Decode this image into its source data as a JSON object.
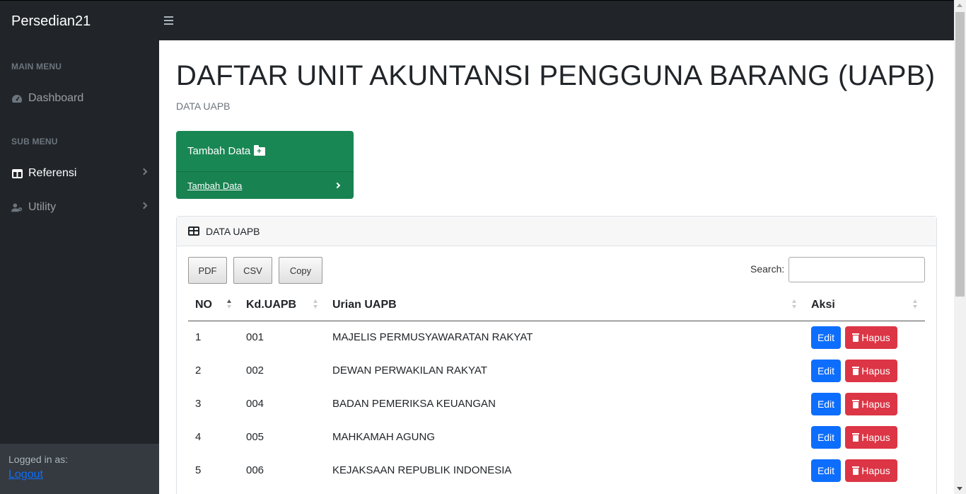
{
  "app": {
    "brand": "Persedian21"
  },
  "sidebar": {
    "main_menu_heading": "MAIN MENU",
    "sub_menu_heading": "SUB MENU",
    "items": [
      {
        "label": "Dashboard",
        "icon": "tachometer-icon"
      },
      {
        "label": "Referensi",
        "icon": "columns-icon",
        "has_submenu": true
      },
      {
        "label": "Utility",
        "icon": "user-cog-icon",
        "has_submenu": true
      }
    ],
    "footer": {
      "logged_in_label": "Logged in as:",
      "logout_label": "Logout"
    }
  },
  "page": {
    "title": "DAFTAR UNIT AKUNTANSI PENGGUNA BARANG (UAPB)",
    "breadcrumb": "DATA UAPB"
  },
  "add_card": {
    "title": "Tambah Data",
    "link_label": "Tambah Data",
    "color": "#198754"
  },
  "data_card": {
    "header": "DATA UAPB",
    "export_buttons": [
      "PDF",
      "CSV",
      "Copy"
    ],
    "search_label": "Search:",
    "search_value": "",
    "columns": [
      "NO",
      "Kd.UAPB",
      "Urian UAPB",
      "Aksi"
    ],
    "rows": [
      {
        "no": "1",
        "kode": "001",
        "uraian": "MAJELIS PERMUSYAWARATAN RAKYAT"
      },
      {
        "no": "2",
        "kode": "002",
        "uraian": "DEWAN PERWAKILAN RAKYAT"
      },
      {
        "no": "3",
        "kode": "004",
        "uraian": "BADAN PEMERIKSA KEUANGAN"
      },
      {
        "no": "4",
        "kode": "005",
        "uraian": "MAHKAMAH AGUNG"
      },
      {
        "no": "5",
        "kode": "006",
        "uraian": "KEJAKSAAN REPUBLIK INDONESIA"
      }
    ],
    "edit_label": "Edit",
    "delete_label": "Hapus",
    "colors": {
      "edit": "#0d6efd",
      "delete": "#dc3545"
    }
  }
}
